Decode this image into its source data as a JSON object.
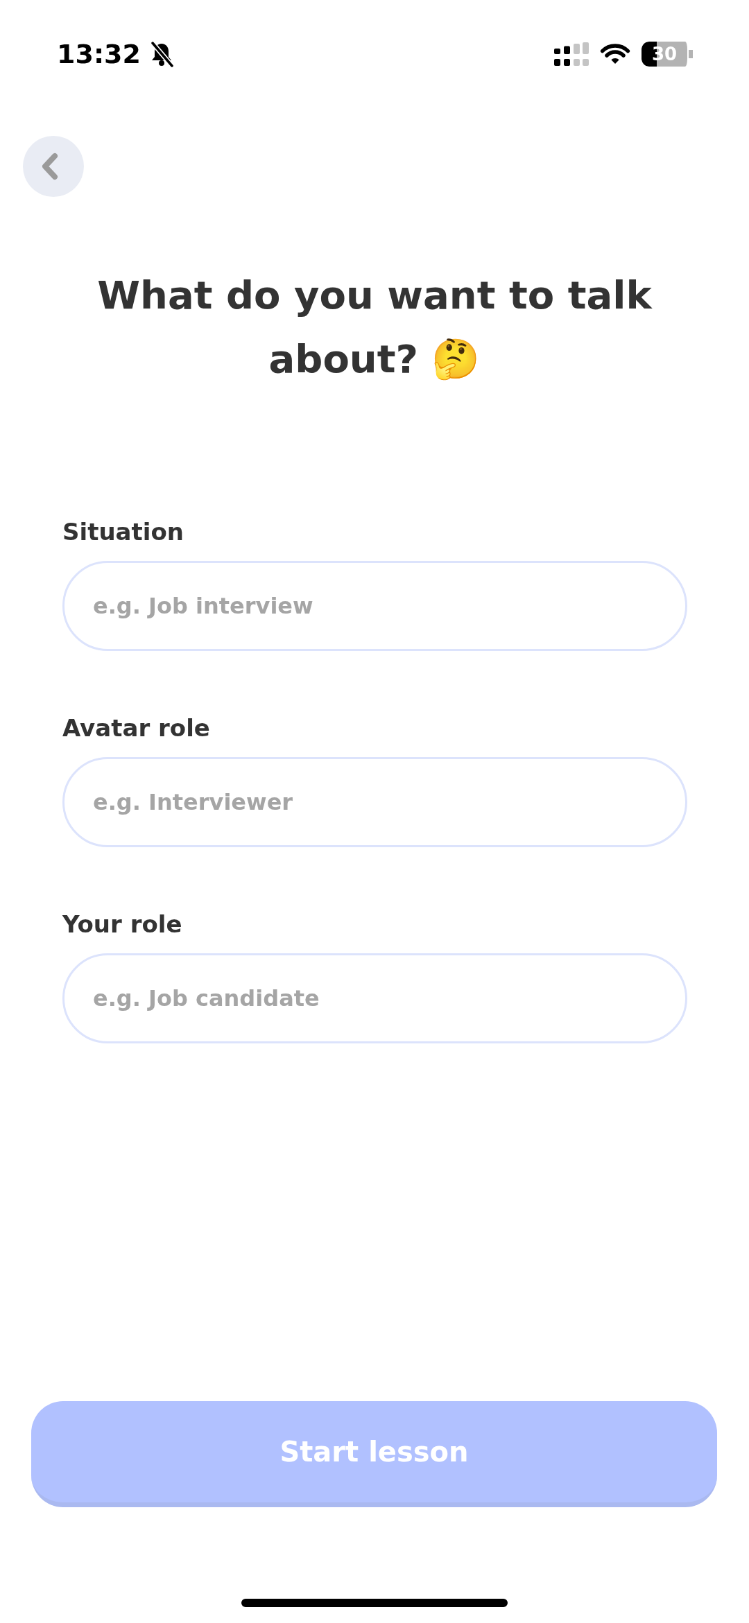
{
  "status_bar": {
    "time": "13:32",
    "battery": "30"
  },
  "title": "What do you want to talk about? 🤔",
  "fields": [
    {
      "label": "Situation",
      "placeholder": "e.g. Job interview"
    },
    {
      "label": "Avatar role",
      "placeholder": "e.g. Interviewer"
    },
    {
      "label": "Your role",
      "placeholder": "e.g. Job candidate"
    }
  ],
  "start_button": {
    "label": "Start lesson",
    "disabled": true
  }
}
